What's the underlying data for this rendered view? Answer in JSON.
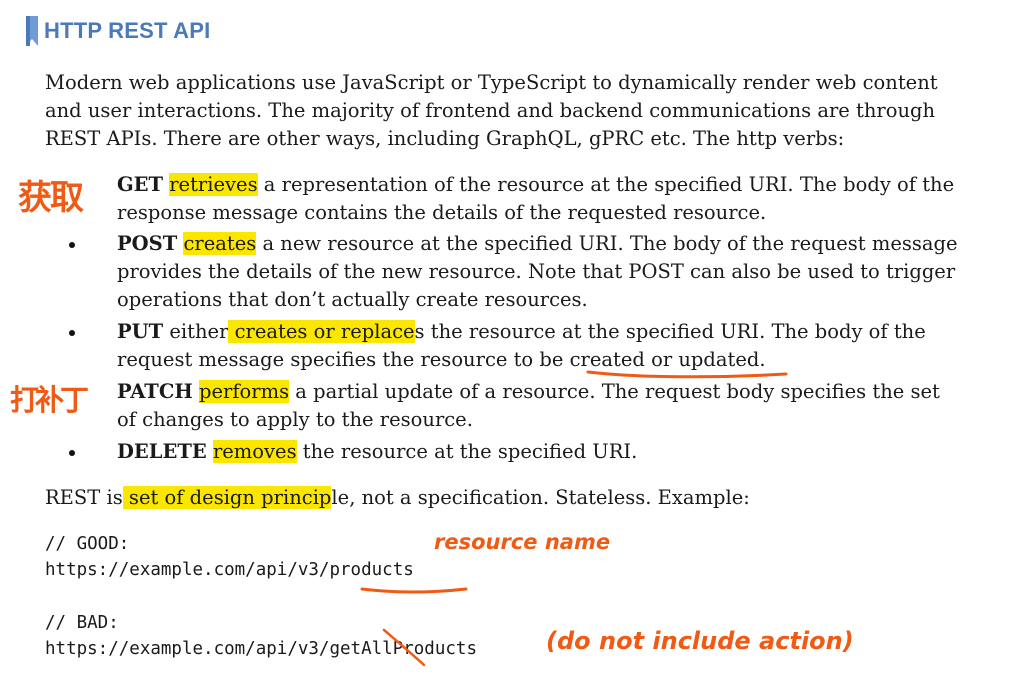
{
  "heading": {
    "title": "HTTP REST API"
  },
  "intro": {
    "lines": [
      "Modern web applications use JavaScript or TypeScript to dynamically render web content",
      "and user interactions. The majority of frontend and backend communications are through",
      "REST APIs. There are other ways, including GraphQL, gPRC etc. The http verbs:"
    ]
  },
  "verbs": [
    {
      "verb": "GET",
      "pre": " ",
      "highlight": "retrieves",
      "rest_line1": " a representation of the resource at the specified URI. The body of the",
      "line2": "response message contains the details of the requested resource."
    },
    {
      "verb": "POST",
      "pre": " ",
      "highlight": "creates",
      "rest_line1": " a new resource at the specified URI. The body of the request message",
      "line2": "provides the details of the new resource. Note that POST can also be used to trigger",
      "line3": "operations that don’t actually create resources."
    },
    {
      "verb": "PUT",
      "pre": " either",
      "highlight": " creates or replace",
      "rest_line1": "s the resource at the specified URI. The body of the",
      "line2_pre": "request message specifies the resource to be ",
      "line2_underlined": "created or updated",
      "line2_post": "."
    },
    {
      "verb": "PATCH",
      "pre": " ",
      "highlight": "performs",
      "rest_line1": " a partial update of a resource. The request body specifies the set",
      "line2": "of changes to apply to the resource."
    },
    {
      "verb": "DELETE",
      "pre": " ",
      "highlight": "removes",
      "rest_line1": " the resource at the specified URI."
    }
  ],
  "rest_line": {
    "pre": "REST is",
    "highlight": " set of design princip",
    "post": "le, not a specification. Stateless. Example:"
  },
  "code_good": {
    "comment": "// GOOD:",
    "url_pre": "https://example.com/api/v3/",
    "url_resource": "products"
  },
  "code_bad": {
    "comment": "// BAD:",
    "url_pre": "https://example.com/api/v3/",
    "url_action": "get",
    "url_post": "AllProducts"
  },
  "annotations": {
    "get_note": "获取",
    "patch_note": "打补丁",
    "resource_note": "resource name",
    "action_note": "(do not include action)"
  },
  "colors": {
    "heading": "#4a7ab8",
    "highlight": "#fbe600",
    "ink": "#f05a14"
  }
}
